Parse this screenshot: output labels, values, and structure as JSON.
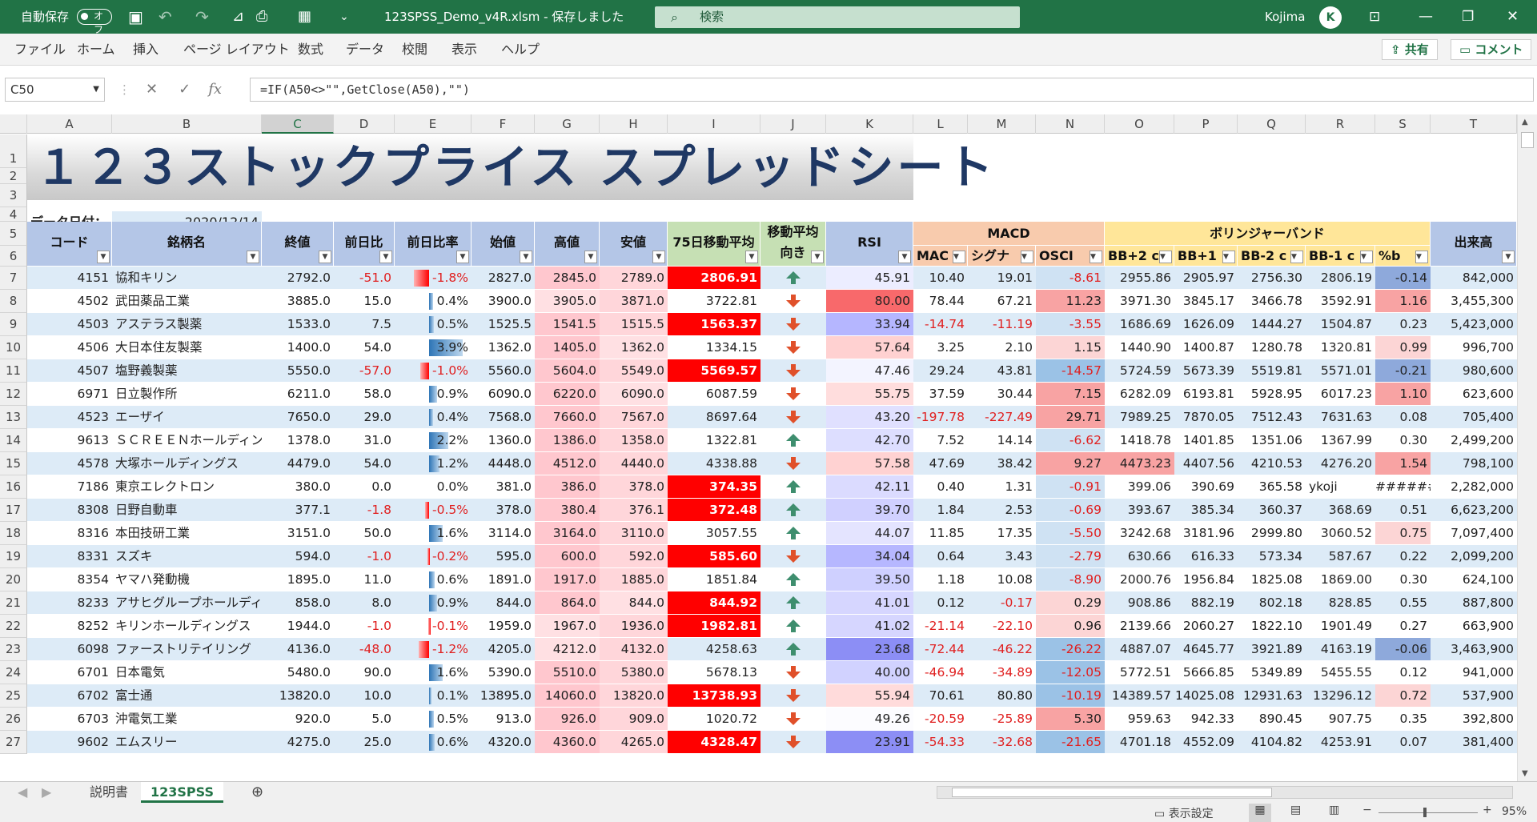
{
  "titlebar": {
    "autosave_label": "自動保存",
    "autosave_state": "オフ",
    "filename": "123SPSS_Demo_v4R.xlsm - 保存しました",
    "search_placeholder": "検索",
    "user": "Kojima",
    "avatar_initial": "K"
  },
  "ribbon": {
    "tabs": [
      "ファイル",
      "ホーム",
      "挿入",
      "ページ レイアウト",
      "数式",
      "データ",
      "校閲",
      "表示",
      "ヘルプ"
    ],
    "share": "共有",
    "comment": "コメント"
  },
  "formula": {
    "name_box": "C50",
    "fx": "fx",
    "value": "=IF(A50<>\"\",GetClose(A50),\"\")"
  },
  "columns": [
    "A",
    "B",
    "C",
    "D",
    "E",
    "F",
    "G",
    "H",
    "I",
    "J",
    "K",
    "L",
    "M",
    "N",
    "O",
    "P",
    "Q",
    "R",
    "S",
    "T"
  ],
  "sheet": {
    "title": "１２３ストックプライス スプレッドシート",
    "date_label": "データ日付：",
    "date_value": "2020/12/14"
  },
  "headers": {
    "code": "コード",
    "name": "銘柄名",
    "close": "終値",
    "change": "前日比",
    "change_pct": "前日比率",
    "open": "始値",
    "high": "高値",
    "low": "安値",
    "ma75": "75日移動平均",
    "ma_dir1": "移動平均",
    "ma_dir2": "向き",
    "rsi": "RSI",
    "macd": "MACD",
    "macd_sub": [
      "MAC",
      "シグナ",
      "OSCI"
    ],
    "bb": "ボリンジャーバンド",
    "bb_sub": [
      "BB+2 c",
      "BB+1",
      "BB-2 c",
      "BB-1 c",
      "%b"
    ],
    "volume": "出来高"
  },
  "rows": [
    {
      "r": "7",
      "code": "4151",
      "name": "協和キリン",
      "close": "2792.0",
      "chg": "-51.0",
      "pct": "-1.8%",
      "open": "2827.0",
      "high": "2845.0",
      "low": "2789.0",
      "ma": "2806.91",
      "mahl": true,
      "dir": "up",
      "rsi": "45.91",
      "mac": "10.40",
      "sig": "19.01",
      "osc": "-8.61",
      "bbp2": "2955.86",
      "bbp1": "2905.97",
      "bbm2": "2756.30",
      "bbm1": "2806.19",
      "pb": "-0.14",
      "vol": "842,000"
    },
    {
      "r": "8",
      "code": "4502",
      "name": "武田薬品工業",
      "close": "3885.0",
      "chg": "15.0",
      "pct": "0.4%",
      "open": "3900.0",
      "high": "3905.0",
      "low": "3871.0",
      "ma": "3722.81",
      "mahl": false,
      "dir": "down",
      "rsi": "80.00",
      "mac": "78.44",
      "sig": "67.21",
      "osc": "11.23",
      "bbp2": "3971.30",
      "bbp1": "3845.17",
      "bbm2": "3466.78",
      "bbm1": "3592.91",
      "pb": "1.16",
      "vol": "3,455,300"
    },
    {
      "r": "9",
      "code": "4503",
      "name": "アステラス製薬",
      "close": "1533.0",
      "chg": "7.5",
      "pct": "0.5%",
      "open": "1525.5",
      "high": "1541.5",
      "low": "1515.5",
      "ma": "1563.37",
      "mahl": true,
      "dir": "down",
      "rsi": "33.94",
      "mac": "-14.74",
      "sig": "-11.19",
      "osc": "-3.55",
      "bbp2": "1686.69",
      "bbp1": "1626.09",
      "bbm2": "1444.27",
      "bbm1": "1504.87",
      "pb": "0.23",
      "vol": "5,423,000"
    },
    {
      "r": "10",
      "code": "4506",
      "name": "大日本住友製薬",
      "close": "1400.0",
      "chg": "54.0",
      "pct": "3.9%",
      "open": "1362.0",
      "high": "1405.0",
      "low": "1362.0",
      "ma": "1334.15",
      "mahl": false,
      "dir": "down",
      "rsi": "57.64",
      "mac": "3.25",
      "sig": "2.10",
      "osc": "1.15",
      "bbp2": "1440.90",
      "bbp1": "1400.87",
      "bbm2": "1280.78",
      "bbm1": "1320.81",
      "pb": "0.99",
      "vol": "996,700"
    },
    {
      "r": "11",
      "code": "4507",
      "name": "塩野義製薬",
      "close": "5550.0",
      "chg": "-57.0",
      "pct": "-1.0%",
      "open": "5560.0",
      "high": "5604.0",
      "low": "5549.0",
      "ma": "5569.57",
      "mahl": true,
      "dir": "down",
      "rsi": "47.46",
      "mac": "29.24",
      "sig": "43.81",
      "osc": "-14.57",
      "bbp2": "5724.59",
      "bbp1": "5673.39",
      "bbm2": "5519.81",
      "bbm1": "5571.01",
      "pb": "-0.21",
      "vol": "980,600"
    },
    {
      "r": "12",
      "code": "6971",
      "name": "日立製作所",
      "close": "6211.0",
      "chg": "58.0",
      "pct": "0.9%",
      "open": "6090.0",
      "high": "6220.0",
      "low": "6090.0",
      "ma": "6087.59",
      "mahl": false,
      "dir": "down",
      "rsi": "55.75",
      "mac": "37.59",
      "sig": "30.44",
      "osc": "7.15",
      "bbp2": "6282.09",
      "bbp1": "6193.81",
      "bbm2": "5928.95",
      "bbm1": "6017.23",
      "pb": "1.10",
      "vol": "623,600"
    },
    {
      "r": "13",
      "code": "4523",
      "name": "エーザイ",
      "close": "7650.0",
      "chg": "29.0",
      "pct": "0.4%",
      "open": "7568.0",
      "high": "7660.0",
      "low": "7567.0",
      "ma": "8697.64",
      "mahl": false,
      "dir": "down",
      "rsi": "43.20",
      "mac": "-197.78",
      "sig": "-227.49",
      "osc": "29.71",
      "bbp2": "7989.25",
      "bbp1": "7870.05",
      "bbm2": "7512.43",
      "bbm1": "7631.63",
      "pb": "0.08",
      "vol": "705,400"
    },
    {
      "r": "14",
      "code": "9613",
      "name": "ＳＣＲＥＥＮホールディン",
      "close": "1378.0",
      "chg": "31.0",
      "pct": "2.2%",
      "open": "1360.0",
      "high": "1386.0",
      "low": "1358.0",
      "ma": "1322.81",
      "mahl": false,
      "dir": "up",
      "rsi": "42.70",
      "mac": "7.52",
      "sig": "14.14",
      "osc": "-6.62",
      "bbp2": "1418.78",
      "bbp1": "1401.85",
      "bbm2": "1351.06",
      "bbm1": "1367.99",
      "pb": "0.30",
      "vol": "2,499,200"
    },
    {
      "r": "15",
      "code": "4578",
      "name": "大塚ホールディングス",
      "close": "4479.0",
      "chg": "54.0",
      "pct": "1.2%",
      "open": "4448.0",
      "high": "4512.0",
      "low": "4440.0",
      "ma": "4338.88",
      "mahl": false,
      "dir": "down",
      "rsi": "57.58",
      "mac": "47.69",
      "sig": "38.42",
      "osc": "9.27",
      "bbp2": "4473.23",
      "bbp1": "4407.56",
      "bbm2": "4210.53",
      "bbm1": "4276.20",
      "pb": "1.54",
      "vol": "798,100"
    },
    {
      "r": "16",
      "code": "7186",
      "name": "東京エレクトロン",
      "close": "380.0",
      "chg": "0.0",
      "pct": "0.0%",
      "open": "381.0",
      "high": "386.0",
      "low": "378.0",
      "ma": "374.35",
      "mahl": true,
      "dir": "up",
      "rsi": "42.11",
      "mac": "0.40",
      "sig": "1.31",
      "osc": "-0.91",
      "bbp2": "399.06",
      "bbp1": "390.69",
      "bbm2": "365.58",
      "bbm1": "ykoji",
      "pb": "######",
      "vol": "2,282,000"
    },
    {
      "r": "17",
      "code": "8308",
      "name": "日野自動車",
      "close": "377.1",
      "chg": "-1.8",
      "pct": "-0.5%",
      "open": "378.0",
      "high": "380.4",
      "low": "376.1",
      "ma": "372.48",
      "mahl": true,
      "dir": "up",
      "rsi": "39.70",
      "mac": "1.84",
      "sig": "2.53",
      "osc": "-0.69",
      "bbp2": "393.67",
      "bbp1": "385.34",
      "bbm2": "360.37",
      "bbm1": "368.69",
      "pb": "0.51",
      "vol": "6,623,200"
    },
    {
      "r": "18",
      "code": "8316",
      "name": "本田技研工業",
      "close": "3151.0",
      "chg": "50.0",
      "pct": "1.6%",
      "open": "3114.0",
      "high": "3164.0",
      "low": "3110.0",
      "ma": "3057.55",
      "mahl": false,
      "dir": "up",
      "rsi": "44.07",
      "mac": "11.85",
      "sig": "17.35",
      "osc": "-5.50",
      "bbp2": "3242.68",
      "bbp1": "3181.96",
      "bbm2": "2999.80",
      "bbm1": "3060.52",
      "pb": "0.75",
      "vol": "7,097,400"
    },
    {
      "r": "19",
      "code": "8331",
      "name": "スズキ",
      "close": "594.0",
      "chg": "-1.0",
      "pct": "-0.2%",
      "open": "595.0",
      "high": "600.0",
      "low": "592.0",
      "ma": "585.60",
      "mahl": true,
      "dir": "down",
      "rsi": "34.04",
      "mac": "0.64",
      "sig": "3.43",
      "osc": "-2.79",
      "bbp2": "630.66",
      "bbp1": "616.33",
      "bbm2": "573.34",
      "bbm1": "587.67",
      "pb": "0.22",
      "vol": "2,099,200"
    },
    {
      "r": "20",
      "code": "8354",
      "name": "ヤマハ発動機",
      "close": "1895.0",
      "chg": "11.0",
      "pct": "0.6%",
      "open": "1891.0",
      "high": "1917.0",
      "low": "1885.0",
      "ma": "1851.84",
      "mahl": false,
      "dir": "up",
      "rsi": "39.50",
      "mac": "1.18",
      "sig": "10.08",
      "osc": "-8.90",
      "bbp2": "2000.76",
      "bbp1": "1956.84",
      "bbm2": "1825.08",
      "bbm1": "1869.00",
      "pb": "0.30",
      "vol": "624,100"
    },
    {
      "r": "21",
      "code": "8233",
      "name": "アサヒグループホールディ",
      "close": "858.0",
      "chg": "8.0",
      "pct": "0.9%",
      "open": "844.0",
      "high": "864.0",
      "low": "844.0",
      "ma": "844.92",
      "mahl": true,
      "dir": "up",
      "rsi": "41.01",
      "mac": "0.12",
      "sig": "-0.17",
      "osc": "0.29",
      "bbp2": "908.86",
      "bbp1": "882.19",
      "bbm2": "802.18",
      "bbm1": "828.85",
      "pb": "0.55",
      "vol": "887,800"
    },
    {
      "r": "22",
      "code": "8252",
      "name": "キリンホールディングス",
      "close": "1944.0",
      "chg": "-1.0",
      "pct": "-0.1%",
      "open": "1959.0",
      "high": "1967.0",
      "low": "1936.0",
      "ma": "1982.81",
      "mahl": true,
      "dir": "up",
      "rsi": "41.02",
      "mac": "-21.14",
      "sig": "-22.10",
      "osc": "0.96",
      "bbp2": "2139.66",
      "bbp1": "2060.27",
      "bbm2": "1822.10",
      "bbm1": "1901.49",
      "pb": "0.27",
      "vol": "663,900"
    },
    {
      "r": "23",
      "code": "6098",
      "name": "ファーストリテイリング",
      "close": "4136.0",
      "chg": "-48.0",
      "pct": "-1.2%",
      "open": "4205.0",
      "high": "4212.0",
      "low": "4132.0",
      "ma": "4258.63",
      "mahl": false,
      "dir": "up",
      "rsi": "23.68",
      "mac": "-72.44",
      "sig": "-46.22",
      "osc": "-26.22",
      "bbp2": "4887.07",
      "bbp1": "4645.77",
      "bbm2": "3921.89",
      "bbm1": "4163.19",
      "pb": "-0.06",
      "vol": "3,463,900"
    },
    {
      "r": "24",
      "code": "6701",
      "name": "日本電気",
      "close": "5480.0",
      "chg": "90.0",
      "pct": "1.6%",
      "open": "5390.0",
      "high": "5510.0",
      "low": "5380.0",
      "ma": "5678.13",
      "mahl": false,
      "dir": "down",
      "rsi": "40.00",
      "mac": "-46.94",
      "sig": "-34.89",
      "osc": "-12.05",
      "bbp2": "5772.51",
      "bbp1": "5666.85",
      "bbm2": "5349.89",
      "bbm1": "5455.55",
      "pb": "0.12",
      "vol": "941,000"
    },
    {
      "r": "25",
      "code": "6702",
      "name": "富士通",
      "close": "13820.0",
      "chg": "10.0",
      "pct": "0.1%",
      "open": "13895.0",
      "high": "14060.0",
      "low": "13820.0",
      "ma": "13738.93",
      "mahl": true,
      "dir": "down",
      "rsi": "55.94",
      "mac": "70.61",
      "sig": "80.80",
      "osc": "-10.19",
      "bbp2": "14389.57",
      "bbp1": "14025.08",
      "bbm2": "12931.63",
      "bbm1": "13296.12",
      "pb": "0.72",
      "vol": "537,900"
    },
    {
      "r": "26",
      "code": "6703",
      "name": "沖電気工業",
      "close": "920.0",
      "chg": "5.0",
      "pct": "0.5%",
      "open": "913.0",
      "high": "926.0",
      "low": "909.0",
      "ma": "1020.72",
      "mahl": false,
      "dir": "down",
      "rsi": "49.26",
      "mac": "-20.59",
      "sig": "-25.89",
      "osc": "5.30",
      "bbp2": "959.63",
      "bbp1": "942.33",
      "bbm2": "890.45",
      "bbm1": "907.75",
      "pb": "0.35",
      "vol": "392,800"
    },
    {
      "r": "27",
      "code": "9602",
      "name": "エムスリー",
      "close": "4275.0",
      "chg": "25.0",
      "pct": "0.6%",
      "open": "4320.0",
      "high": "4360.0",
      "low": "4265.0",
      "ma": "4328.47",
      "mahl": true,
      "dir": "down",
      "rsi": "23.91",
      "mac": "-54.33",
      "sig": "-32.68",
      "osc": "-21.65",
      "bbp2": "4701.18",
      "bbp1": "4552.09",
      "bbm2": "4104.82",
      "bbm1": "4253.91",
      "pb": "0.07",
      "vol": "381,400"
    }
  ],
  "sheet_tabs": [
    "説明書",
    "123SPSS"
  ],
  "status": {
    "display_settings": "表示設定",
    "zoom": "95%"
  }
}
